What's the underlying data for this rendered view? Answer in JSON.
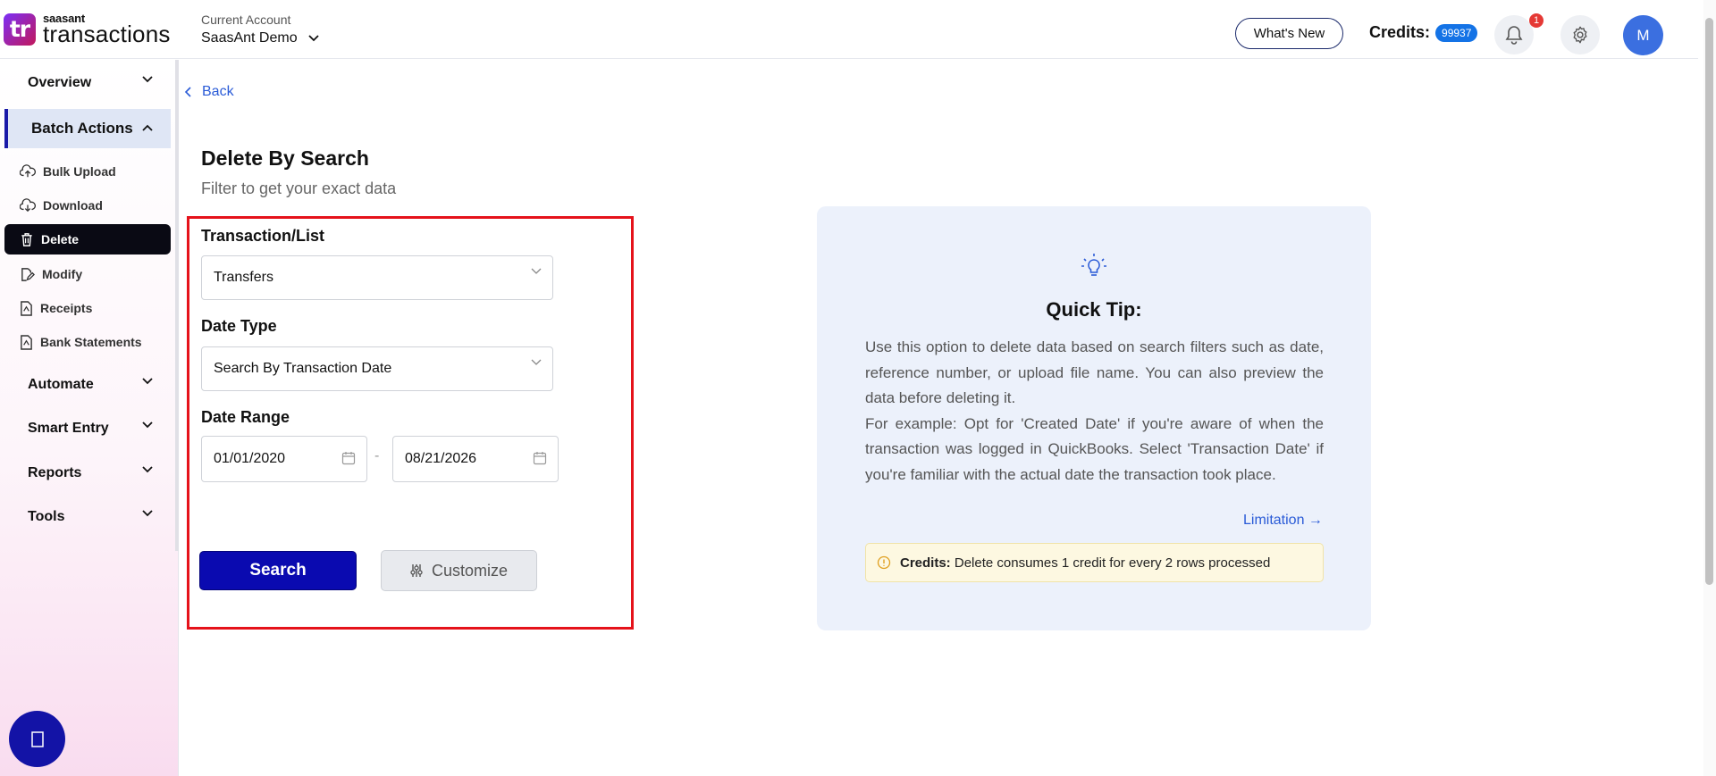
{
  "brand": {
    "mark": "tr",
    "small": "saasant",
    "big": "transactions"
  },
  "account": {
    "label": "Current Account",
    "value": "SaasAnt Demo"
  },
  "header": {
    "whats_new": "What's New",
    "credits_label": "Credits:",
    "credits_value": "99937",
    "notification_count": "1",
    "avatar_initial": "M"
  },
  "sidebar": {
    "groups": {
      "overview": "Overview",
      "batch_actions": "Batch Actions",
      "automate": "Automate",
      "smart_entry": "Smart Entry",
      "reports": "Reports",
      "tools": "Tools"
    },
    "items": {
      "bulk_upload": "Bulk Upload",
      "download": "Download",
      "delete": "Delete",
      "modify": "Modify",
      "receipts": "Receipts",
      "bank_statements": "Bank Statements"
    }
  },
  "main": {
    "back": "Back",
    "title": "Delete By Search",
    "subtitle": "Filter to get your exact data",
    "form": {
      "transaction_label": "Transaction/List",
      "transaction_value": "Transfers",
      "date_type_label": "Date Type",
      "date_type_value": "Search By Transaction Date",
      "date_range_label": "Date Range",
      "date_from": "01/01/2020",
      "date_separator": "-",
      "date_to": "08/21/2026",
      "search_button": "Search",
      "customize_button": "Customize"
    }
  },
  "tip": {
    "title": "Quick Tip:",
    "para1": "Use this option to delete data based on search filters such as date, reference number, or upload file name. You can also preview the data before deleting it.",
    "para2": "For example: Opt for 'Created Date' if you're aware of when the transaction was logged in QuickBooks. Select 'Transaction Date' if you're familiar with the actual date the transaction took place.",
    "link": "Limitation →",
    "credit_label": "Credits:",
    "credit_text": "Delete consumes 1 credit for every 2 rows processed"
  },
  "colors": {
    "primary": "#0a0ab0",
    "highlight_border": "#e5121b",
    "accent_blue": "#1473e6",
    "tip_bg": "#ecf1fb"
  }
}
